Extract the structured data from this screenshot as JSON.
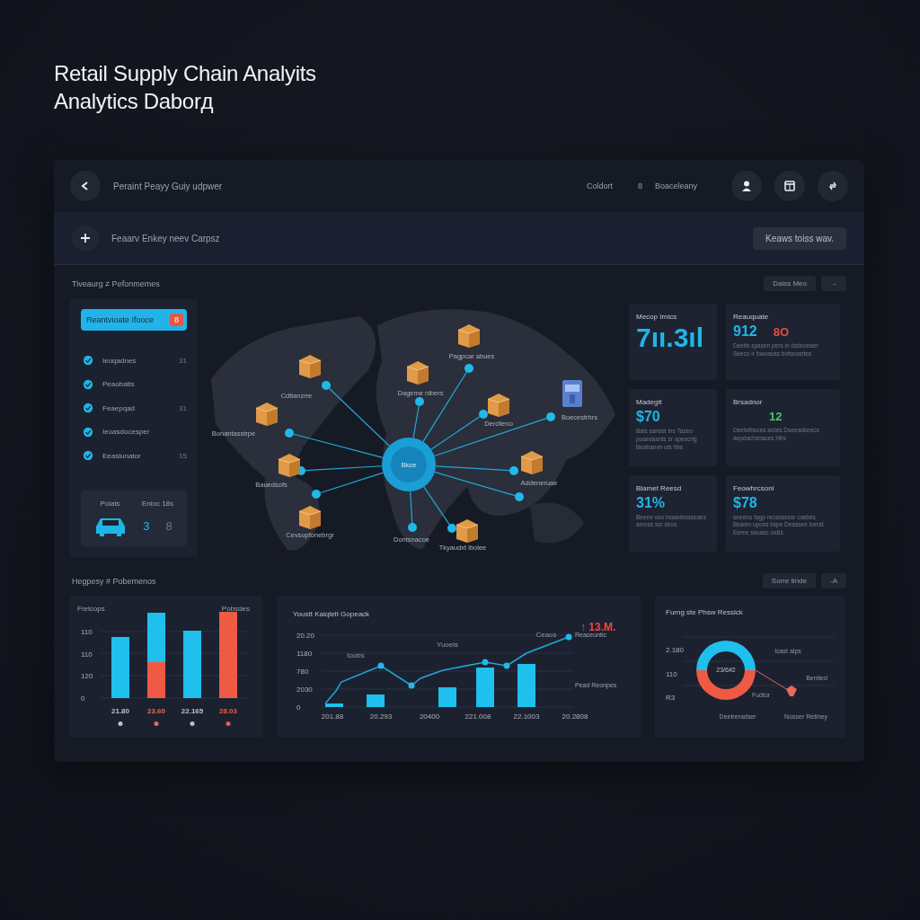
{
  "page_title": [
    "Retail Supply Chain Analyits",
    "Analytics Daborд"
  ],
  "top_bar": {
    "title": "Peraint Peayy Guiy udpwer",
    "links": [
      "Coldort",
      "8",
      "Boaceleany"
    ]
  },
  "action_bar": {
    "text": "Feaarv Enkey neev Carpsz",
    "button": "Keaws toiss wav."
  },
  "section_1": {
    "heading": "Tiveaurg ≠ Pefonmemes",
    "button": "Daiss Meo",
    "arrow": "→"
  },
  "sidebar": {
    "primary": {
      "label": "Reantvioate Ifooce",
      "badge": "8"
    },
    "items": [
      {
        "label": "Ieoqadnes",
        "count": "31"
      },
      {
        "label": "Peaobatis"
      },
      {
        "label": "Feaepqad",
        "count": "31"
      },
      {
        "label": "Ieoasdocesper"
      },
      {
        "label": "Eeaslunator",
        "count": "15"
      }
    ],
    "fleet": {
      "label": "Polats",
      "caption": "Enioc 18s",
      "values": [
        "3",
        "8"
      ]
    }
  },
  "map": {
    "hub": "Bkce",
    "labels": [
      "Cdtlanzrre",
      "Bonantasstrpe",
      "Bauedsofs",
      "Cevsupfonebrgr",
      "Dageme nibers",
      "Pagpcar abues",
      "Derclleno",
      "Boecestrhrs",
      "Addeneruae",
      "Dontsnacoe",
      "Tkyaudxt ibolee"
    ]
  },
  "kpis": [
    {
      "title": "Mecop Irnics",
      "value": "7ıı.3ıl"
    },
    {
      "title": "Reauquate",
      "value": "912",
      "delta": "8O",
      "color": "#e0503f",
      "text": "Deeits spasen pers in dsdoceaer Seeco ir foanaoss bofsnosttes"
    },
    {
      "title": "Madegit",
      "value": "$70",
      "text": "Bals sanset ins Tazeo poaeeaonis sr opeecrig Beahanvn uts hbs"
    },
    {
      "title": "Brsadnor",
      "delta": "12",
      "color": "#4fc26a",
      "text": "Deetuthsoes ardes Dseeadseecs aepdachsnaces Hbs"
    },
    {
      "title": "Blamet Reesd",
      "value": "31%",
      "text": "Beeee vuo hsaadsssseaes amoss ssr sbos"
    },
    {
      "title": "Feowhrcsoni",
      "value": "$78",
      "text": "seeeno fagp recaosssar casbes Bsarsn uposs bspe Deessee loerst Eeree seuasc oe8s"
    }
  ],
  "section_2": {
    "heading": "Hegpesy # Pobemenos",
    "button": "Sorre tinde",
    "arrow": "-A"
  },
  "bar_card": {
    "label_left": "Frelcops",
    "label_right": "Pobsdes",
    "yticks": [
      "110",
      "110",
      "120",
      "0"
    ],
    "categories": [
      {
        "label": "21.80",
        "color": "#b9c3cf"
      },
      {
        "label": "23.60",
        "color": "#e0705a"
      },
      {
        "label": "22.165",
        "color": "#b9c3cf"
      },
      {
        "label": "28.03",
        "color": "#ef5a44"
      }
    ]
  },
  "line_card": {
    "title": "Youstt Kaiqtelt Gopeack",
    "yticks": [
      "20.20",
      "1180",
      "780",
      "2030",
      "0"
    ],
    "xticks": [
      "201.88",
      "20.293",
      "20400",
      "221.008",
      "22.1003",
      "20.2808"
    ],
    "point_labels": [
      "toobs",
      "Yuoeis",
      "Ceaos"
    ],
    "highlight": "↑ 13.M.",
    "legend": [
      "Reaceuntic",
      "Pead Reonpes"
    ]
  },
  "donut_card": {
    "title": "Furng ste Phsw Resslck",
    "yticks": [
      "2.180",
      "110",
      "R3"
    ],
    "center": "23/6#2",
    "labels": [
      "Icast alps",
      "Bentied",
      "Fudtor",
      "Deetreradser",
      "Nosser Retiney"
    ]
  }
}
